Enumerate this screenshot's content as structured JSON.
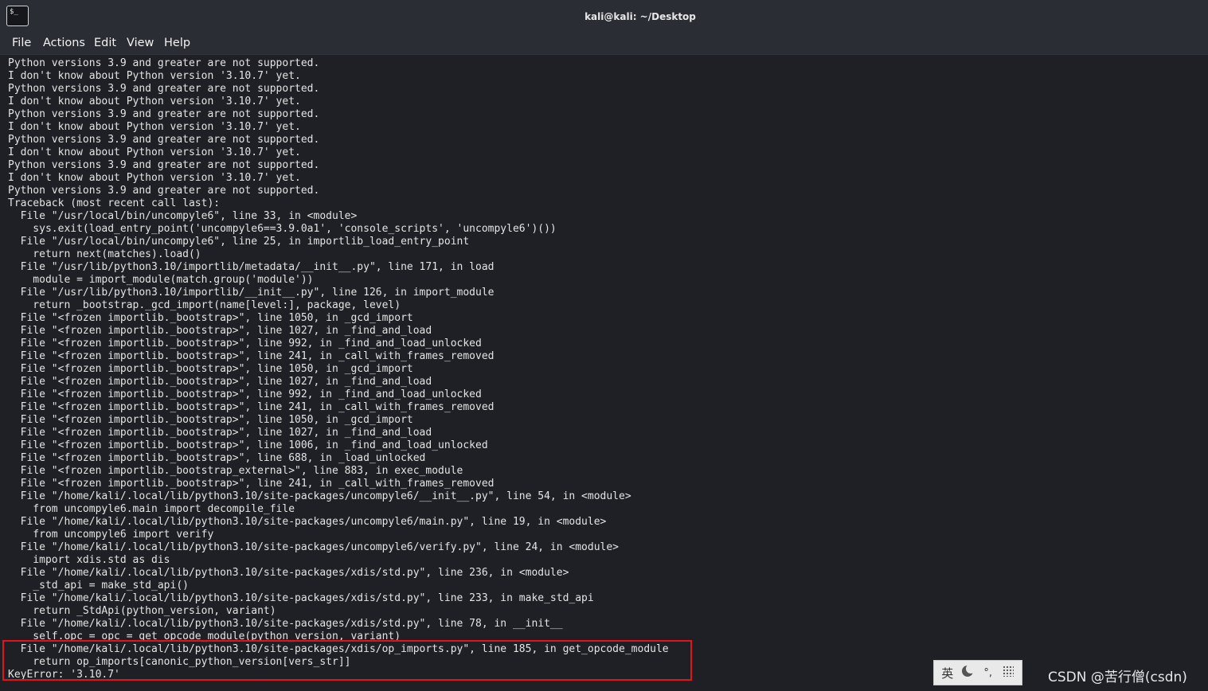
{
  "window": {
    "title": "kali@kali: ~/Desktop",
    "icon_text": "$_"
  },
  "menu": [
    "File",
    "Actions",
    "Edit",
    "View",
    "Help"
  ],
  "terminal_lines": [
    "Python versions 3.9 and greater are not supported.",
    "I don't know about Python version '3.10.7' yet.",
    "Python versions 3.9 and greater are not supported.",
    "I don't know about Python version '3.10.7' yet.",
    "Python versions 3.9 and greater are not supported.",
    "I don't know about Python version '3.10.7' yet.",
    "Python versions 3.9 and greater are not supported.",
    "I don't know about Python version '3.10.7' yet.",
    "Python versions 3.9 and greater are not supported.",
    "I don't know about Python version '3.10.7' yet.",
    "Python versions 3.9 and greater are not supported.",
    "Traceback (most recent call last):",
    "  File \"/usr/local/bin/uncompyle6\", line 33, in <module>",
    "    sys.exit(load_entry_point('uncompyle6==3.9.0a1', 'console_scripts', 'uncompyle6')())",
    "  File \"/usr/local/bin/uncompyle6\", line 25, in importlib_load_entry_point",
    "    return next(matches).load()",
    "  File \"/usr/lib/python3.10/importlib/metadata/__init__.py\", line 171, in load",
    "    module = import_module(match.group('module'))",
    "  File \"/usr/lib/python3.10/importlib/__init__.py\", line 126, in import_module",
    "    return _bootstrap._gcd_import(name[level:], package, level)",
    "  File \"<frozen importlib._bootstrap>\", line 1050, in _gcd_import",
    "  File \"<frozen importlib._bootstrap>\", line 1027, in _find_and_load",
    "  File \"<frozen importlib._bootstrap>\", line 992, in _find_and_load_unlocked",
    "  File \"<frozen importlib._bootstrap>\", line 241, in _call_with_frames_removed",
    "  File \"<frozen importlib._bootstrap>\", line 1050, in _gcd_import",
    "  File \"<frozen importlib._bootstrap>\", line 1027, in _find_and_load",
    "  File \"<frozen importlib._bootstrap>\", line 992, in _find_and_load_unlocked",
    "  File \"<frozen importlib._bootstrap>\", line 241, in _call_with_frames_removed",
    "  File \"<frozen importlib._bootstrap>\", line 1050, in _gcd_import",
    "  File \"<frozen importlib._bootstrap>\", line 1027, in _find_and_load",
    "  File \"<frozen importlib._bootstrap>\", line 1006, in _find_and_load_unlocked",
    "  File \"<frozen importlib._bootstrap>\", line 688, in _load_unlocked",
    "  File \"<frozen importlib._bootstrap_external>\", line 883, in exec_module",
    "  File \"<frozen importlib._bootstrap>\", line 241, in _call_with_frames_removed",
    "  File \"/home/kali/.local/lib/python3.10/site-packages/uncompyle6/__init__.py\", line 54, in <module>",
    "    from uncompyle6.main import decompile_file",
    "  File \"/home/kali/.local/lib/python3.10/site-packages/uncompyle6/main.py\", line 19, in <module>",
    "    from uncompyle6 import verify",
    "  File \"/home/kali/.local/lib/python3.10/site-packages/uncompyle6/verify.py\", line 24, in <module>",
    "    import xdis.std as dis",
    "  File \"/home/kali/.local/lib/python3.10/site-packages/xdis/std.py\", line 236, in <module>",
    "    _std_api = make_std_api()",
    "  File \"/home/kali/.local/lib/python3.10/site-packages/xdis/std.py\", line 233, in make_std_api",
    "    return _StdApi(python_version, variant)",
    "  File \"/home/kali/.local/lib/python3.10/site-packages/xdis/std.py\", line 78, in __init__",
    "    self.opc = opc = get_opcode_module(python_version, variant)",
    "  File \"/home/kali/.local/lib/python3.10/site-packages/xdis/op_imports.py\", line 185, in get_opcode_module",
    "    return op_imports[canonic_python_version[vers_str]]",
    "KeyError: '3.10.7'"
  ],
  "ime": {
    "lang": "英",
    "punct": "'',"
  },
  "watermark": "CSDN @苦行僧(csdn)",
  "colors": {
    "background": "#1e2025",
    "text": "#e4e4e4",
    "highlight_border": "#e3121b"
  }
}
